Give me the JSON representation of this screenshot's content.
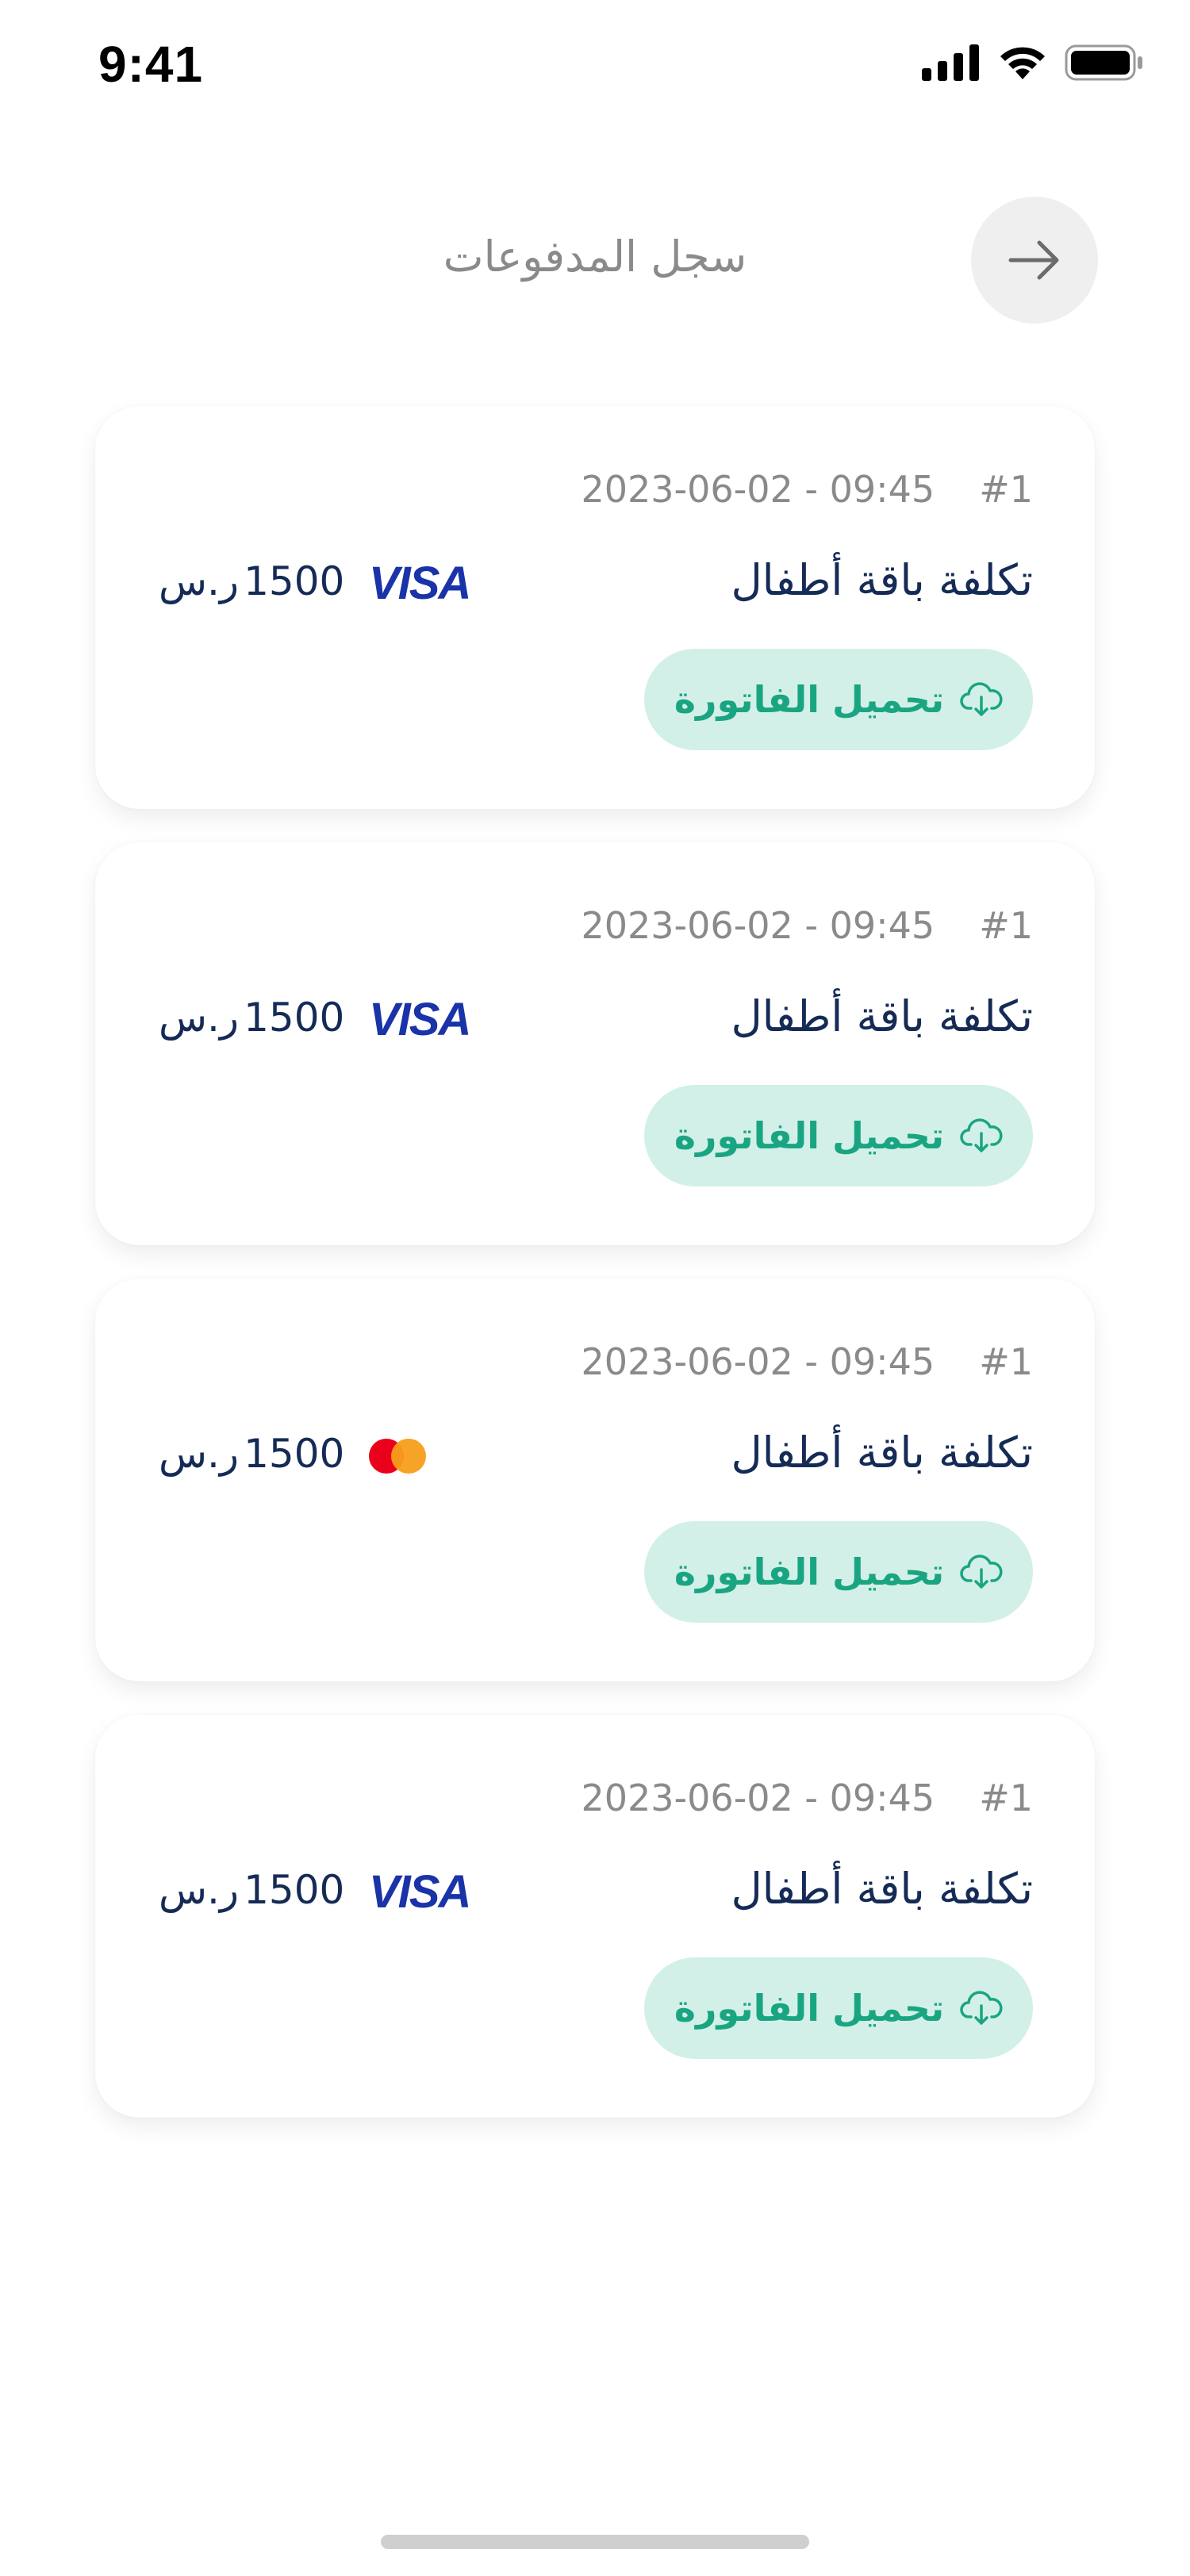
{
  "status_bar": {
    "time": "9:41"
  },
  "header": {
    "title": "سجل المدفوعات",
    "back_icon": "arrow-right-icon"
  },
  "payments": [
    {
      "index": "#1",
      "datetime": "2023-06-02 - 09:45",
      "title": "تكلفة باقة أطفال",
      "amount": "1500",
      "currency": "ر.س",
      "card_brand": "VISA",
      "download_label": "تحميل الفاتورة"
    },
    {
      "index": "#1",
      "datetime": "2023-06-02 - 09:45",
      "title": "تكلفة باقة أطفال",
      "amount": "1500",
      "currency": "ر.س",
      "card_brand": "VISA",
      "download_label": "تحميل الفاتورة"
    },
    {
      "index": "#1",
      "datetime": "2023-06-02 - 09:45",
      "title": "تكلفة باقة أطفال",
      "amount": "1500",
      "currency": "ر.س",
      "card_brand": "mastercard",
      "download_label": "تحميل الفاتورة"
    },
    {
      "index": "#1",
      "datetime": "2023-06-02 - 09:45",
      "title": "تكلفة باقة أطفال",
      "amount": "1500",
      "currency": "ر.س",
      "card_brand": "VISA",
      "download_label": "تحميل الفاتورة"
    }
  ],
  "colors": {
    "primary_text": "#152b56",
    "muted_text": "#8a8a8a",
    "accent_green": "#1aa582",
    "accent_green_bg": "#d3f0e8",
    "visa_blue": "#1a33a8"
  }
}
